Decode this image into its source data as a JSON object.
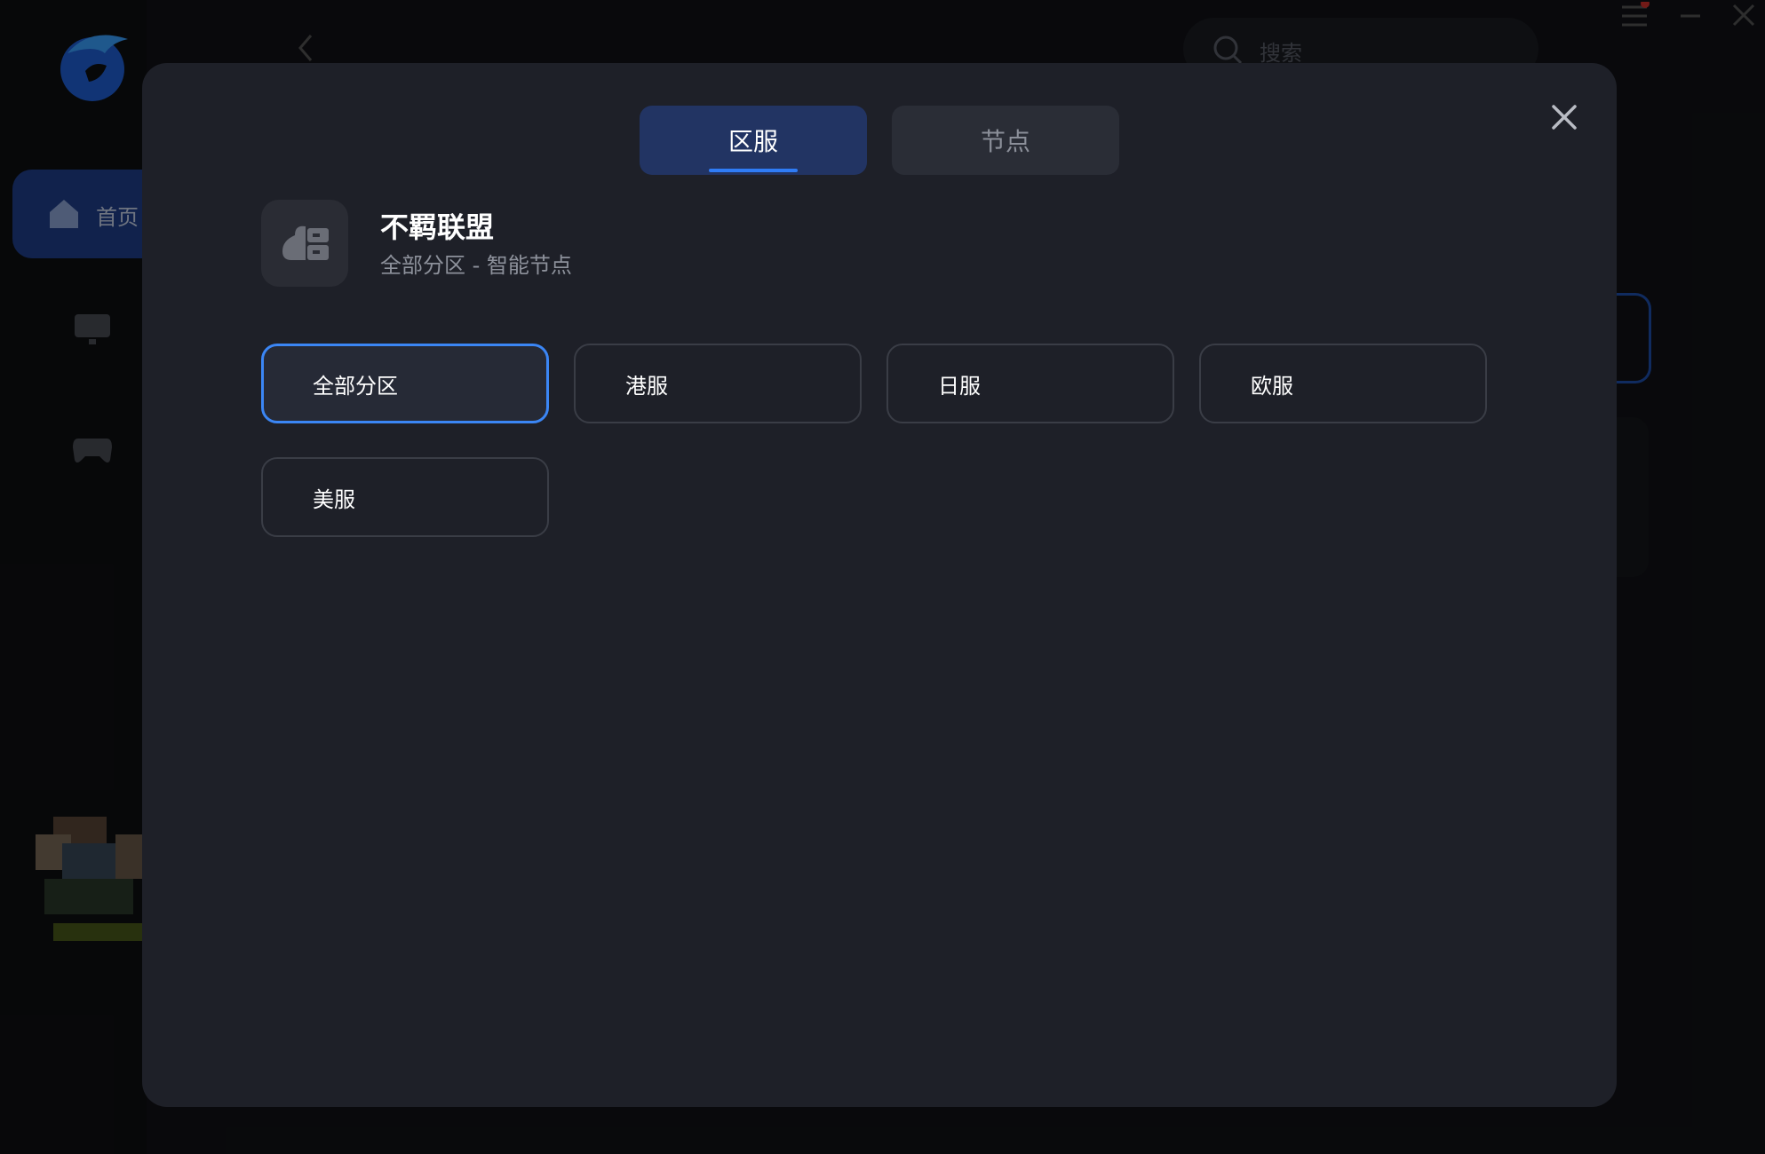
{
  "background": {
    "nav_home_label": "首页",
    "search_placeholder": "搜索",
    "icons": {
      "logo": "dolphin-logo-icon",
      "home": "home-icon",
      "monitor": "monitor-icon",
      "gamepad": "gamepad-icon",
      "back": "chevron-left-icon",
      "search": "search-icon",
      "menu": "menu-icon",
      "minimize": "minimize-icon",
      "close": "close-icon"
    }
  },
  "modal": {
    "tabs": [
      {
        "label": "区服",
        "active": true
      },
      {
        "label": "节点",
        "active": false
      }
    ],
    "game": {
      "title": "不羁联盟",
      "subtitle": "全部分区 - 智能节点",
      "icon": "cloud-server-icon"
    },
    "regions": [
      {
        "label": "全部分区",
        "selected": true
      },
      {
        "label": "港服",
        "selected": false
      },
      {
        "label": "日服",
        "selected": false
      },
      {
        "label": "欧服",
        "selected": false
      },
      {
        "label": "美服",
        "selected": false
      }
    ],
    "close_icon": "close-icon"
  },
  "colors": {
    "accent": "#3b86f5",
    "tab_active_bg": "#223463",
    "modal_bg": "#1e2028"
  }
}
